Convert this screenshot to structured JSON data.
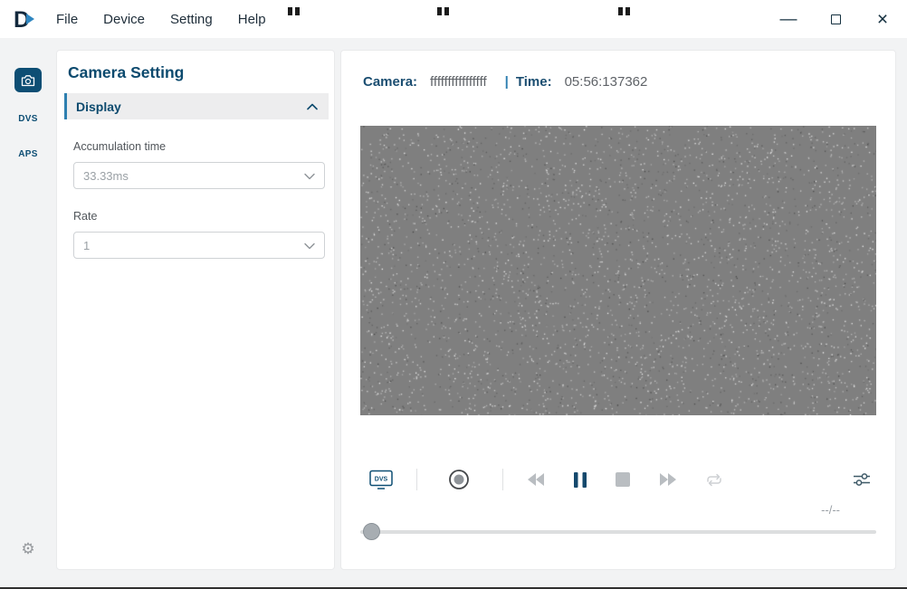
{
  "colors": {
    "accent": "#0d4e74",
    "accent_blue": "#2e7fb0",
    "heading_text": "#0c4a6e",
    "video_background": "#7f7f7f"
  },
  "titlebar": {
    "logo_letter": "D",
    "menu": [
      {
        "label": "File"
      },
      {
        "label": "Device"
      },
      {
        "label": "Setting"
      },
      {
        "label": "Help"
      }
    ],
    "window_controls": {
      "minimize": "—",
      "close": "×"
    }
  },
  "sidebar": {
    "tabs": [
      {
        "id": "camera",
        "label": "",
        "selected": true,
        "icon": "camera-icon"
      },
      {
        "id": "dvs",
        "label": "DVS",
        "selected": false
      },
      {
        "id": "aps",
        "label": "APS",
        "selected": false
      }
    ],
    "gear_icon": "⚙"
  },
  "settings": {
    "title": "Camera Setting",
    "section_title": "Display",
    "fields": [
      {
        "label": "Accumulation time",
        "value": "33.33ms"
      },
      {
        "label": "Rate",
        "value": "1"
      }
    ]
  },
  "main": {
    "camera_label": "Camera:",
    "camera_value": "ffffffffffffffff",
    "divider": "|",
    "time_label": "Time:",
    "time_value": "05:56:137362",
    "progress_text": "--/--",
    "dvs_icon_label": "DVS",
    "control_icons": [
      "dvs-monitor",
      "record",
      "rewind",
      "pause",
      "stop",
      "fast-forward",
      "loop",
      "tune"
    ]
  }
}
